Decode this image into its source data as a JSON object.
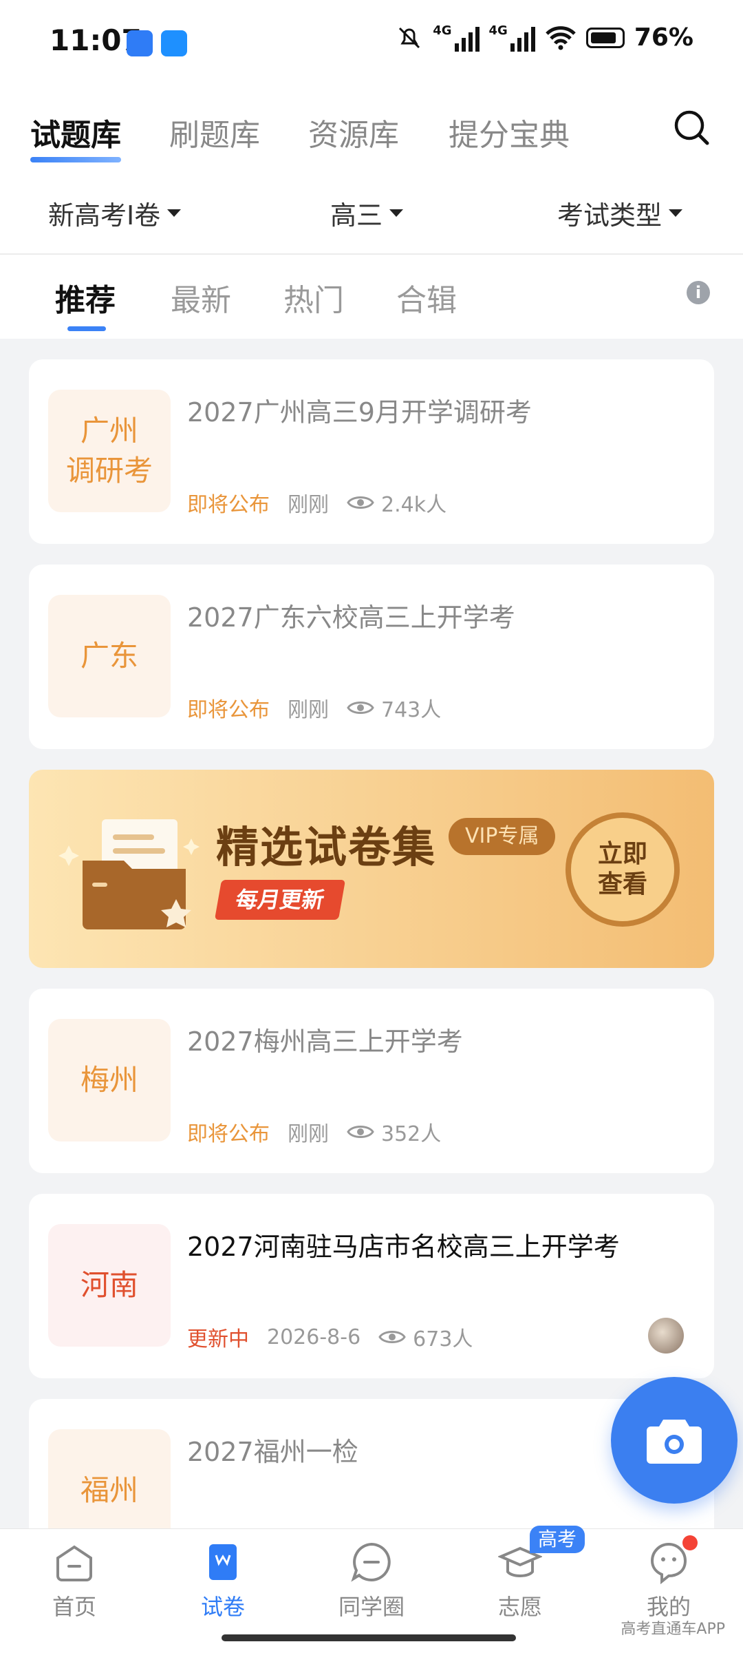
{
  "status_bar": {
    "time": "11:07",
    "battery": "76%",
    "net1": "4G",
    "net2": "4G"
  },
  "main_tabs": [
    "试题库",
    "刷题库",
    "资源库",
    "提分宝典"
  ],
  "filters": [
    "新高考Ⅰ卷",
    "高三",
    "考试类型"
  ],
  "sub_tabs": [
    "推荐",
    "最新",
    "热门",
    "合辑"
  ],
  "cards": [
    {
      "badge": "广州\n调研考",
      "title": "2027广州高三9月开学调研考",
      "status": "即将公布",
      "time": "刚刚",
      "views": "2.4k人"
    },
    {
      "badge": "广东",
      "title": "2027广东六校高三上开学考",
      "status": "即将公布",
      "time": "刚刚",
      "views": "743人"
    },
    {
      "badge": "梅州",
      "title": "2027梅州高三上开学考",
      "status": "即将公布",
      "time": "刚刚",
      "views": "352人"
    },
    {
      "badge": "河南",
      "title": "2027河南驻马店市名校高三上开学考",
      "status": "更新中",
      "time": "2026-8-6",
      "views": "673人"
    },
    {
      "badge": "福州",
      "title": "2027福州一检"
    }
  ],
  "banner": {
    "title": "精选试卷集",
    "vip": "VIP专属",
    "monthly": "每月更新",
    "button": "立即\n查看"
  },
  "bottom_nav": {
    "home": "首页",
    "papers": "试卷",
    "circle": "同学圈",
    "wish": "志愿",
    "mine": "我的",
    "badge": "高考"
  },
  "watermark": "高考直通车APP",
  "colors": {
    "accent": "#2f7cf6",
    "orange": "#e9953a",
    "red": "#e0502e"
  }
}
